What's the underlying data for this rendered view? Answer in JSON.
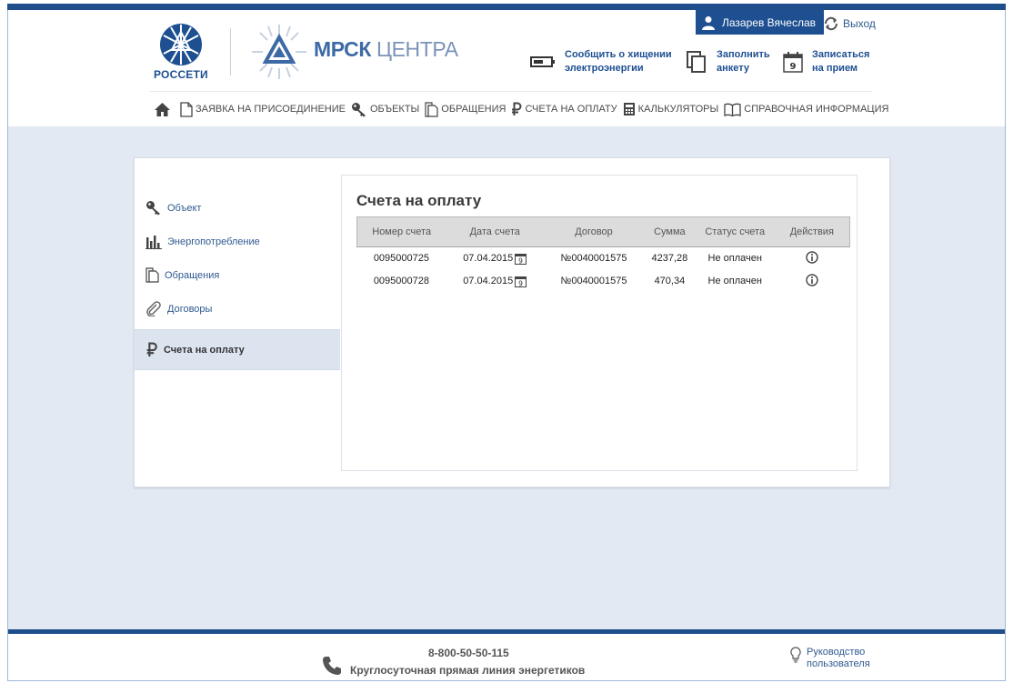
{
  "header": {
    "user_name": "Лазарев Вячеслав",
    "logout_label": "Выход",
    "brand_rosseti": "РОССЕТИ",
    "brand_mrsk_bold": "МРСК",
    "brand_mrsk_light": "ЦЕНТРА",
    "actions": [
      {
        "line1": "Сообщить о хищении",
        "line2": "электроэнергии",
        "icon": "battery-icon"
      },
      {
        "line1": "Заполнить",
        "line2": "анкету",
        "icon": "documents-icon"
      },
      {
        "line1": "Записаться",
        "line2": "на прием",
        "icon": "calendar-icon",
        "icon_text": "9"
      }
    ]
  },
  "nav": {
    "items": [
      {
        "label": "ЗАЯВКА НА ПРИСОЕДИНЕНИЕ",
        "icon": "document-icon"
      },
      {
        "label": "ОБЪЕКТЫ",
        "icon": "key-icon"
      },
      {
        "label": "ОБРАЩЕНИЯ",
        "icon": "copy-icon"
      },
      {
        "label": "СЧЕТА НА ОПЛАТУ",
        "icon": "ruble-icon"
      },
      {
        "label": "КАЛЬКУЛЯТОРЫ",
        "icon": "calculator-icon"
      },
      {
        "label": "СПРАВОЧНАЯ ИНФОРМАЦИЯ",
        "icon": "book-icon"
      }
    ]
  },
  "sidebar": {
    "items": [
      {
        "label": "Объект",
        "icon": "key-icon"
      },
      {
        "label": "Энергопотребление",
        "icon": "bar-chart-icon"
      },
      {
        "label": "Обращения",
        "icon": "copy-icon"
      },
      {
        "label": "Договоры",
        "icon": "paperclip-icon"
      },
      {
        "label": "Счета на оплату",
        "icon": "ruble-icon",
        "active": true
      }
    ]
  },
  "panel": {
    "title": "Счета на оплату",
    "columns": [
      "Номер счета",
      "Дата счета",
      "Договор",
      "Сумма",
      "Статус счета",
      "Действия"
    ],
    "rows": [
      {
        "number": "0095000725",
        "date": "07.04.2015",
        "contract": "№0040001575",
        "amount": "4237,28",
        "status": "Не оплачен"
      },
      {
        "number": "0095000728",
        "date": "07.04.2015",
        "contract": "№0040001575",
        "amount": "470,34",
        "status": "Не оплачен"
      }
    ],
    "calendar_day": "9"
  },
  "footer": {
    "phone": "8-800-50-50-115",
    "phone_desc": "Круглосуточная прямая линия энергетиков",
    "manual_line1": "Руководство",
    "manual_line2": "пользователя"
  },
  "colors": {
    "primary": "#1d4f91",
    "main_bg": "#e3e9f3",
    "active_item": "#dce4f0"
  }
}
